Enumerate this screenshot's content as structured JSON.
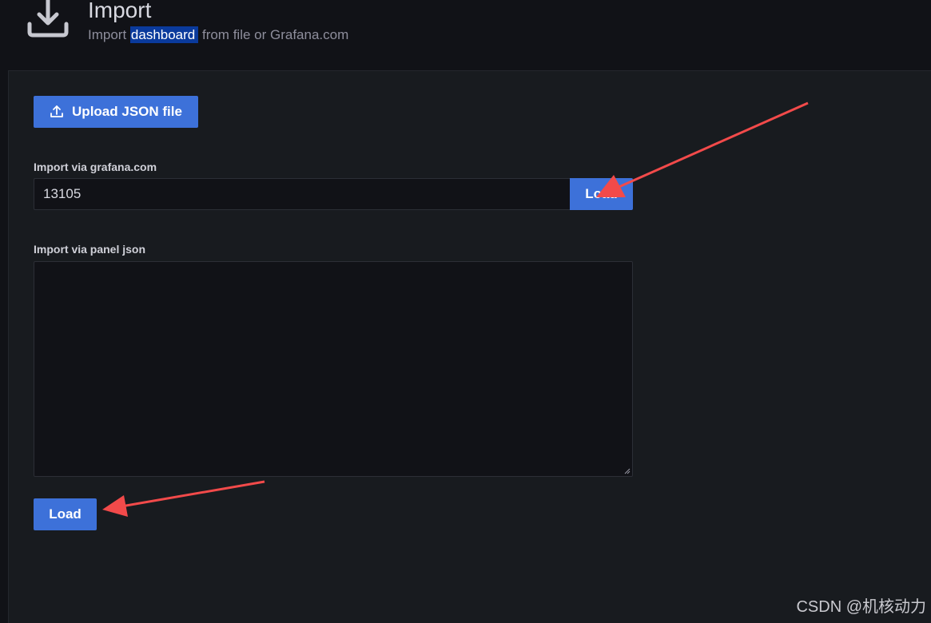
{
  "header": {
    "icon": "import-download-icon",
    "title": "Import",
    "subtitle_prefix": "Import ",
    "subtitle_highlight": "dashboard",
    "subtitle_suffix": " from file or Grafana.com"
  },
  "upload": {
    "icon": "upload-icon",
    "label": "Upload JSON file"
  },
  "grafana_com": {
    "label": "Import via grafana.com",
    "value": "13105",
    "load_label": "Load"
  },
  "panel_json": {
    "label": "Import via panel json",
    "value": ""
  },
  "bottom": {
    "load_label": "Load"
  },
  "annotations": {
    "arrow_color": "#f24a4a"
  },
  "watermark": "CSDN @机核动力",
  "colors": {
    "accent": "#3d71d9",
    "background": "#111217",
    "panel": "#181b1f",
    "highlight": "#0a3a9c"
  }
}
